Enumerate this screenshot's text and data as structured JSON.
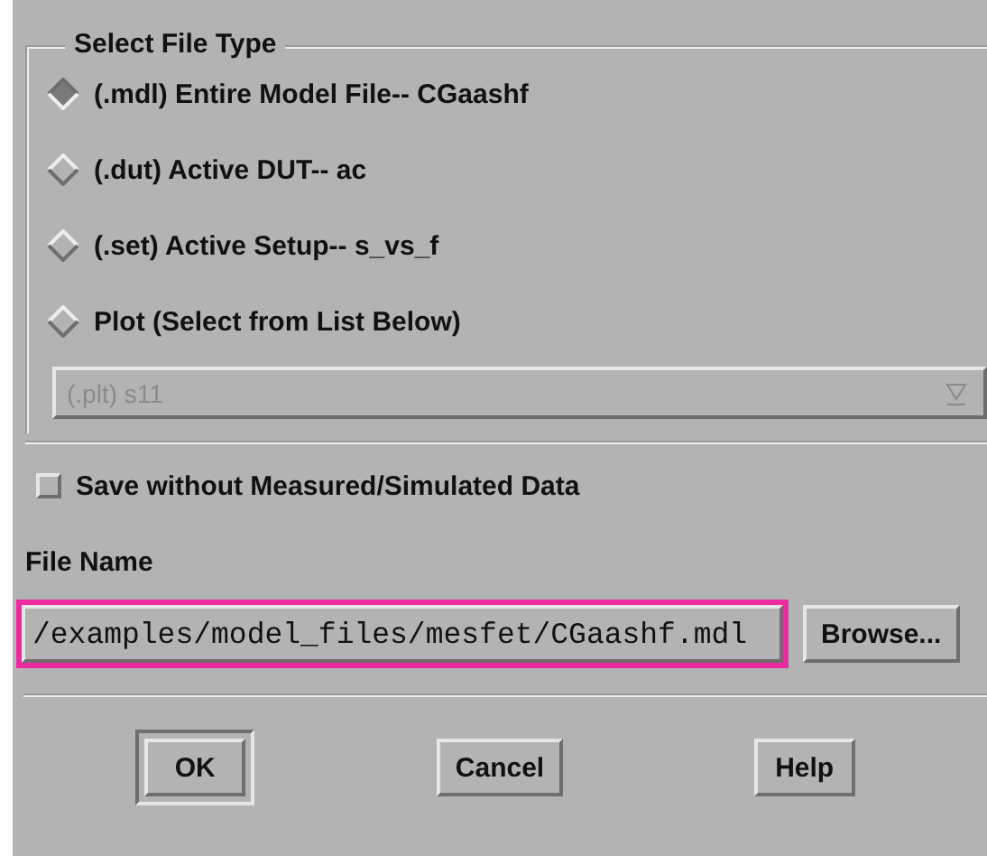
{
  "group": {
    "title": "Select File Type"
  },
  "options": [
    {
      "label": "(.mdl) Entire Model File-- CGaashf",
      "selected": true
    },
    {
      "label": "(.dut) Active DUT-- ac",
      "selected": false
    },
    {
      "label": "(.set) Active Setup-- s_vs_f",
      "selected": false
    },
    {
      "label": "Plot (Select from List Below)",
      "selected": false
    }
  ],
  "plot_list": {
    "value": "(.plt) s11",
    "disabled": true
  },
  "save_without_data": {
    "label": "Save without Measured/Simulated Data",
    "checked": false
  },
  "file_name": {
    "label": "File Name",
    "value": "/examples/model_files/mesfet/CGaashf.mdl",
    "highlighted": true
  },
  "browse_button": "Browse...",
  "buttons": [
    {
      "label": "OK",
      "default": true
    },
    {
      "label": "Cancel",
      "default": false
    },
    {
      "label": "Help",
      "default": false
    }
  ]
}
